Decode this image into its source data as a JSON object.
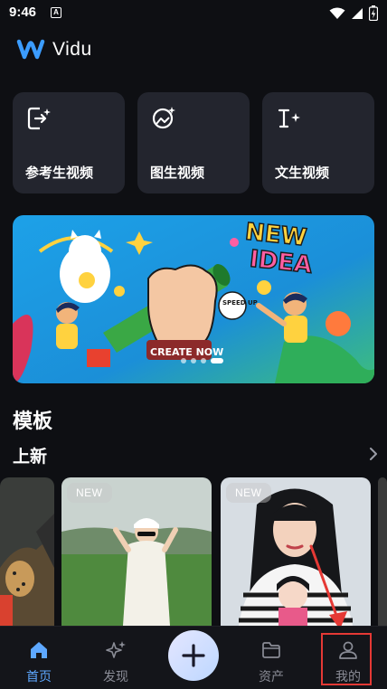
{
  "status_bar": {
    "time": "9:46",
    "notification_glyph": "A"
  },
  "brand": {
    "name": "Vidu",
    "logo_color": "#3b9cff"
  },
  "tools": [
    {
      "label": "参考生视频",
      "icon": "reference-video-icon"
    },
    {
      "label": "图生视频",
      "icon": "image-video-icon"
    },
    {
      "label": "文生视频",
      "icon": "text-video-icon"
    }
  ],
  "banner": {
    "headline_line1": "NEW",
    "headline_line2": "IDEA",
    "badge_text": "SPEED UP",
    "wristband_text": "CREATE NOW",
    "dots": 4,
    "active_dot": 3
  },
  "templates": {
    "title": "模板",
    "subsection": "上新",
    "cards": [
      {
        "badge": "",
        "kind": "leopard"
      },
      {
        "badge": "NEW",
        "kind": "golfer"
      },
      {
        "badge": "NEW",
        "kind": "portrait"
      }
    ]
  },
  "bottom_nav": {
    "items": [
      {
        "label": "首页",
        "icon": "home-icon",
        "active": true
      },
      {
        "label": "发现",
        "icon": "sparkle-icon",
        "active": false
      },
      {
        "label": "资产",
        "icon": "folder-icon",
        "active": false
      },
      {
        "label": "我的",
        "icon": "profile-icon",
        "active": false
      }
    ],
    "create_icon": "plus-icon"
  },
  "colors": {
    "accent": "#5ea8ff",
    "card_bg": "#23252e",
    "page_bg": "#0e0f13",
    "highlight": "#e53935"
  }
}
